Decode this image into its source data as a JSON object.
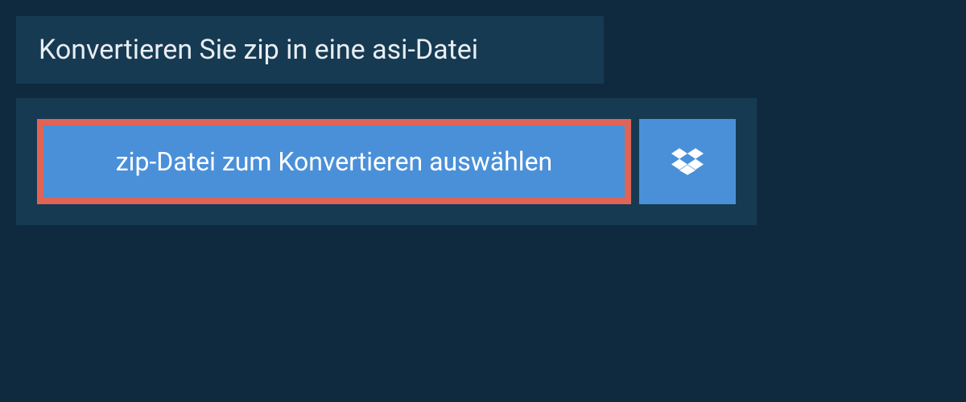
{
  "header": {
    "title": "Konvertieren Sie zip in eine asi-Datei"
  },
  "buttons": {
    "select_file": "zip-Datei zum Konvertieren auswählen"
  },
  "colors": {
    "background": "#0f2a3f",
    "panel": "#173a53",
    "button": "#4a90d9",
    "highlight_border": "#e06456",
    "text_light": "#e8eef2",
    "text_white": "#ffffff"
  }
}
